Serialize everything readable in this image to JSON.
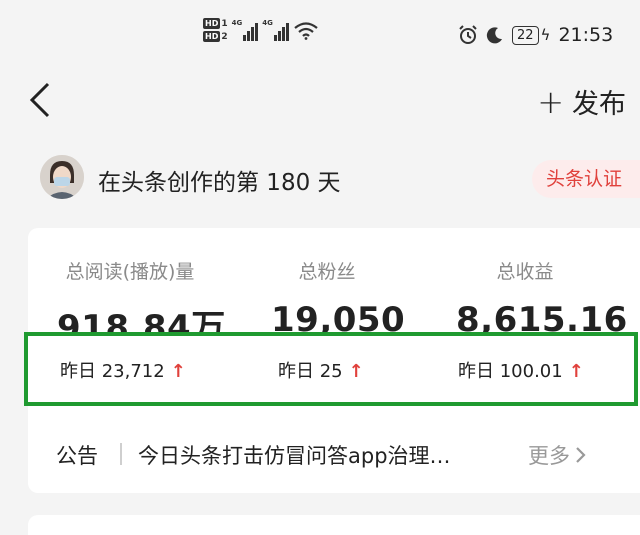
{
  "status_bar": {
    "sim1": "HD",
    "sim1_num": "1",
    "sim2": "HD",
    "sim2_num": "2",
    "net1": "4G",
    "net2": "4G",
    "battery": "22",
    "time": "21:53",
    "icons": [
      "alarm-icon",
      "moon-icon",
      "charging-icon",
      "wifi-icon",
      "signal-icon"
    ]
  },
  "header": {
    "back_icon": "chevron-left-icon",
    "publish_plus": "+",
    "publish_label": "发布"
  },
  "creator": {
    "text": "在头条创作的第 180 天",
    "badge": "头条认证"
  },
  "stats": [
    {
      "label": "总阅读(播放)量",
      "value": "918.84万",
      "yesterday": "昨日 23,712",
      "trend": "↑"
    },
    {
      "label": "总粉丝",
      "value": "19,050",
      "yesterday": "昨日 25",
      "trend": "↑"
    },
    {
      "label": "总收益",
      "value": "8,615.16",
      "yesterday": "昨日 100.01",
      "trend": "↑"
    }
  ],
  "notice": {
    "label": "公告",
    "text": "今日头条打击仿冒问答app治理…",
    "more": "更多",
    "more_icon": "chevron-right-icon"
  },
  "colors": {
    "accent_red": "#e0413c",
    "highlight_green": "#1f9a30",
    "background": "#f4f4f4"
  }
}
